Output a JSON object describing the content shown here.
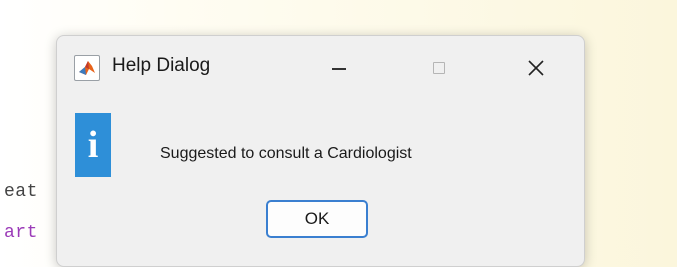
{
  "editor": {
    "line1": "eat",
    "line2": "art"
  },
  "dialog": {
    "title": "Help Dialog",
    "app_icon": "matlab-icon",
    "message": "Suggested to consult a Cardiologist",
    "ok_label": "OK",
    "info_icon_glyph": "i",
    "colors": {
      "info_icon_bg": "#2e8fd8",
      "ok_border": "#3a7fd0"
    }
  }
}
